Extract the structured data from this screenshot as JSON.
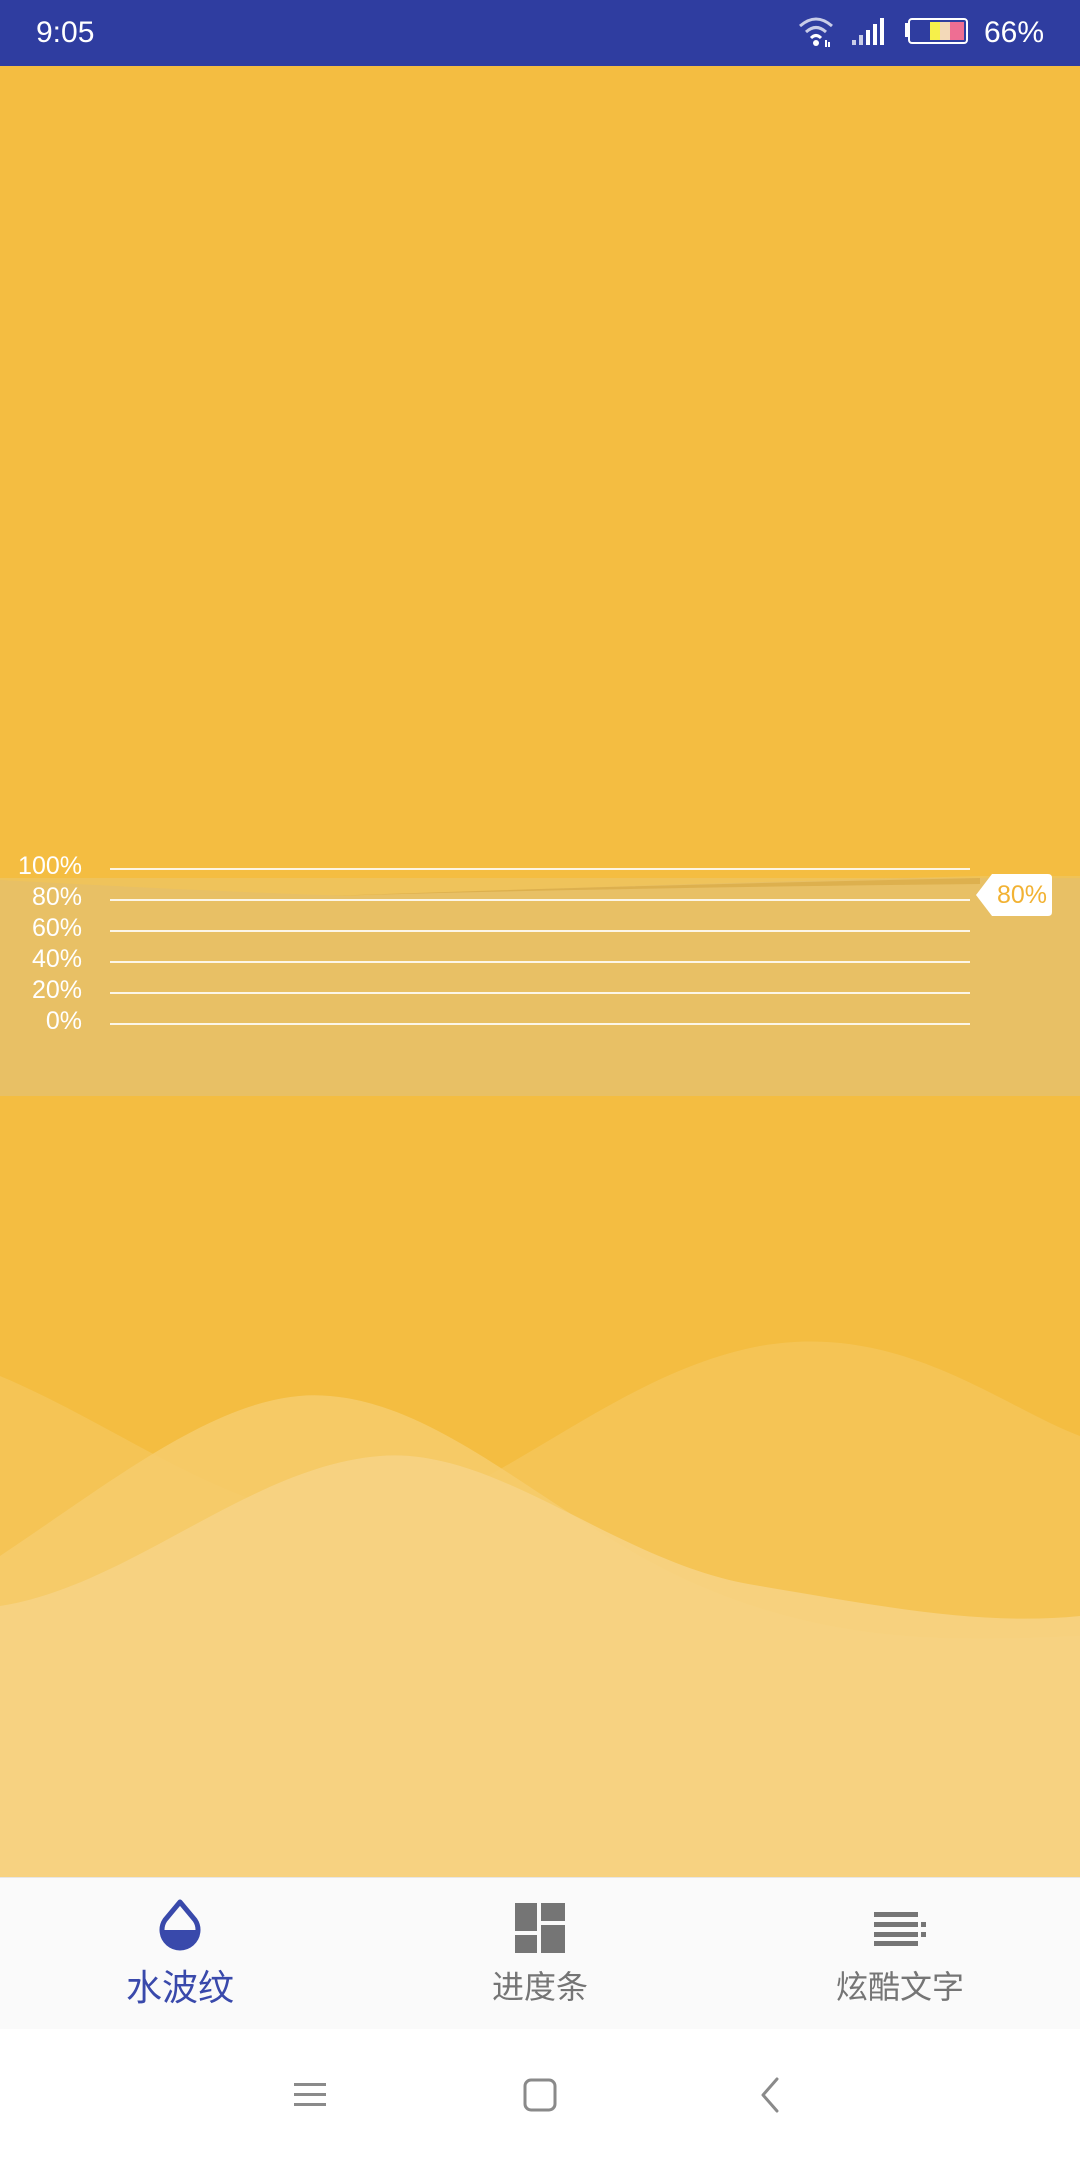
{
  "status_bar": {
    "time": "9:05",
    "battery_percent": "66%",
    "background_color": "#2f3da0",
    "icons": [
      "wifi-icon",
      "signal-icon",
      "battery-icon"
    ]
  },
  "main": {
    "background_color": "#f4bd41",
    "gauge": {
      "ticks": [
        "100%",
        "80%",
        "60%",
        "40%",
        "20%",
        "0%"
      ],
      "current_value": "80%",
      "value_fraction": 0.8
    }
  },
  "bottom_nav": {
    "items": [
      {
        "label": "水波纹",
        "icon": "water-drop-icon",
        "active": true
      },
      {
        "label": "进度条",
        "icon": "dashboard-icon",
        "active": false
      },
      {
        "label": "炫酷文字",
        "icon": "text-lines-icon",
        "active": false
      }
    ],
    "active_color": "#3949ab",
    "inactive_color": "#757575"
  },
  "system_nav": {
    "buttons": [
      "menu-icon",
      "home-icon",
      "back-icon"
    ]
  }
}
